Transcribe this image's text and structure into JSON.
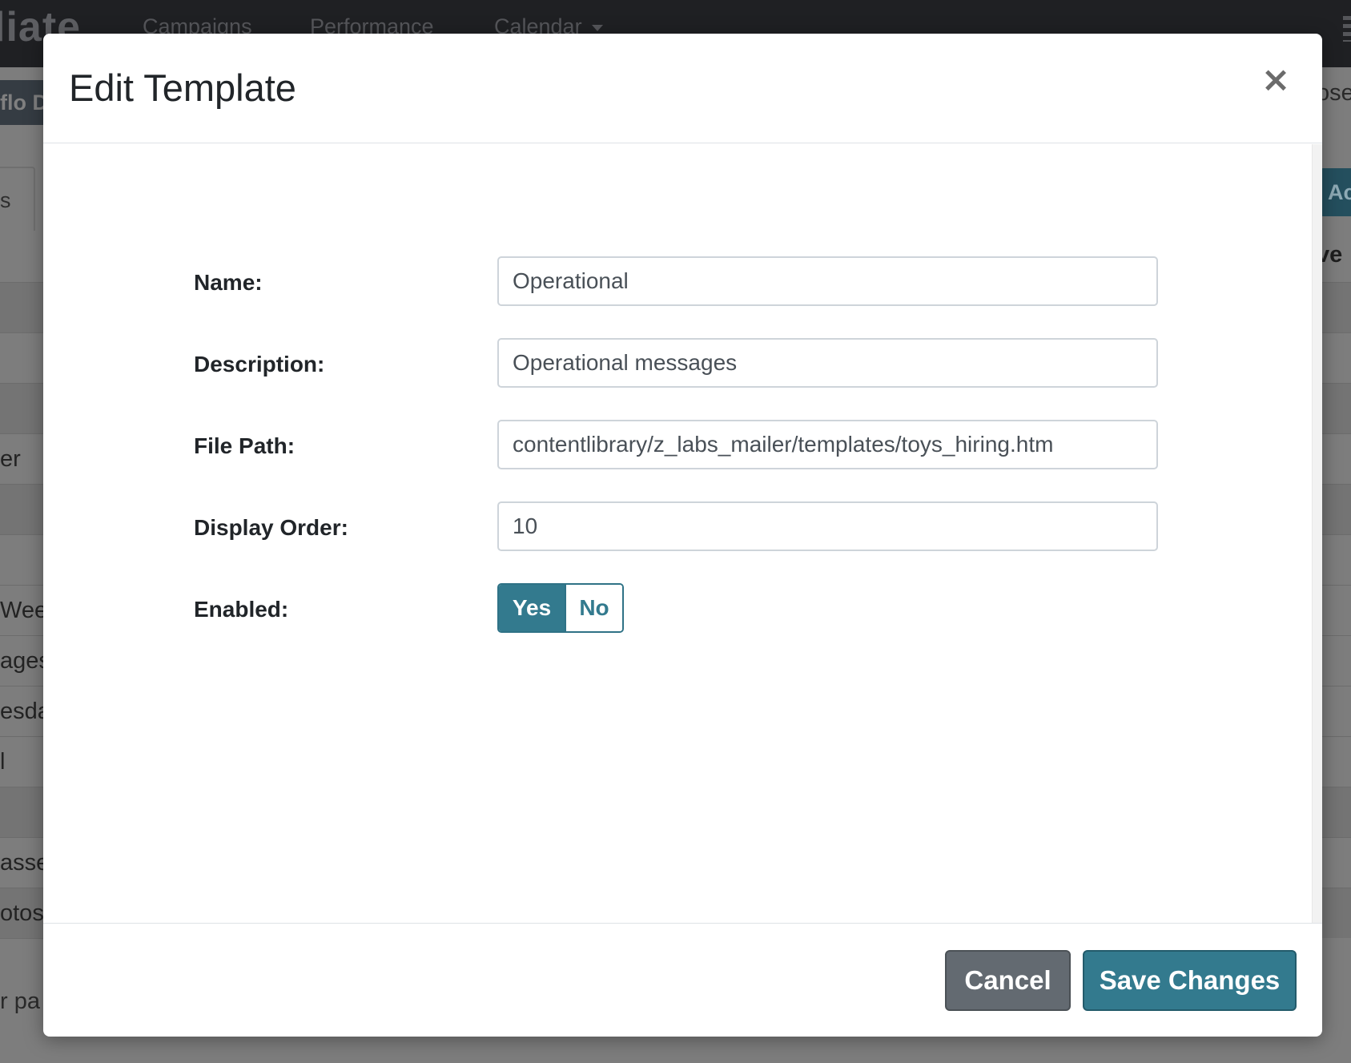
{
  "background": {
    "logo": "liate",
    "nav": [
      {
        "label": "Campaigns"
      },
      {
        "label": "Performance"
      },
      {
        "label": "Calendar"
      }
    ],
    "chip_label": "flo D",
    "tab_label": "s",
    "left_rows": [
      "",
      "",
      "",
      "er",
      "",
      "",
      "Week",
      "ages",
      "esda",
      "l",
      "",
      "asse",
      "otos",
      ""
    ],
    "right_label": "ose",
    "right_button": "Ac",
    "right_header": "ve",
    "footer_text": "r pa"
  },
  "modal": {
    "title": "Edit Template",
    "close_symbol": "×",
    "fields": {
      "name": {
        "label": "Name:",
        "value": "Operational"
      },
      "description": {
        "label": "Description:",
        "value": "Operational messages"
      },
      "file_path": {
        "label": "File Path:",
        "value": "contentlibrary/z_labs_mailer/templates/toys_hiring.htm"
      },
      "display_order": {
        "label": "Display Order:",
        "value": "10"
      },
      "enabled": {
        "label": "Enabled:",
        "yes_label": "Yes",
        "no_label": "No",
        "selected": "Yes"
      }
    },
    "buttons": {
      "cancel": "Cancel",
      "save": "Save Changes"
    }
  },
  "colors": {
    "primary": "#337a8e",
    "secondary": "#636a71",
    "navbar": "#1f2023"
  }
}
